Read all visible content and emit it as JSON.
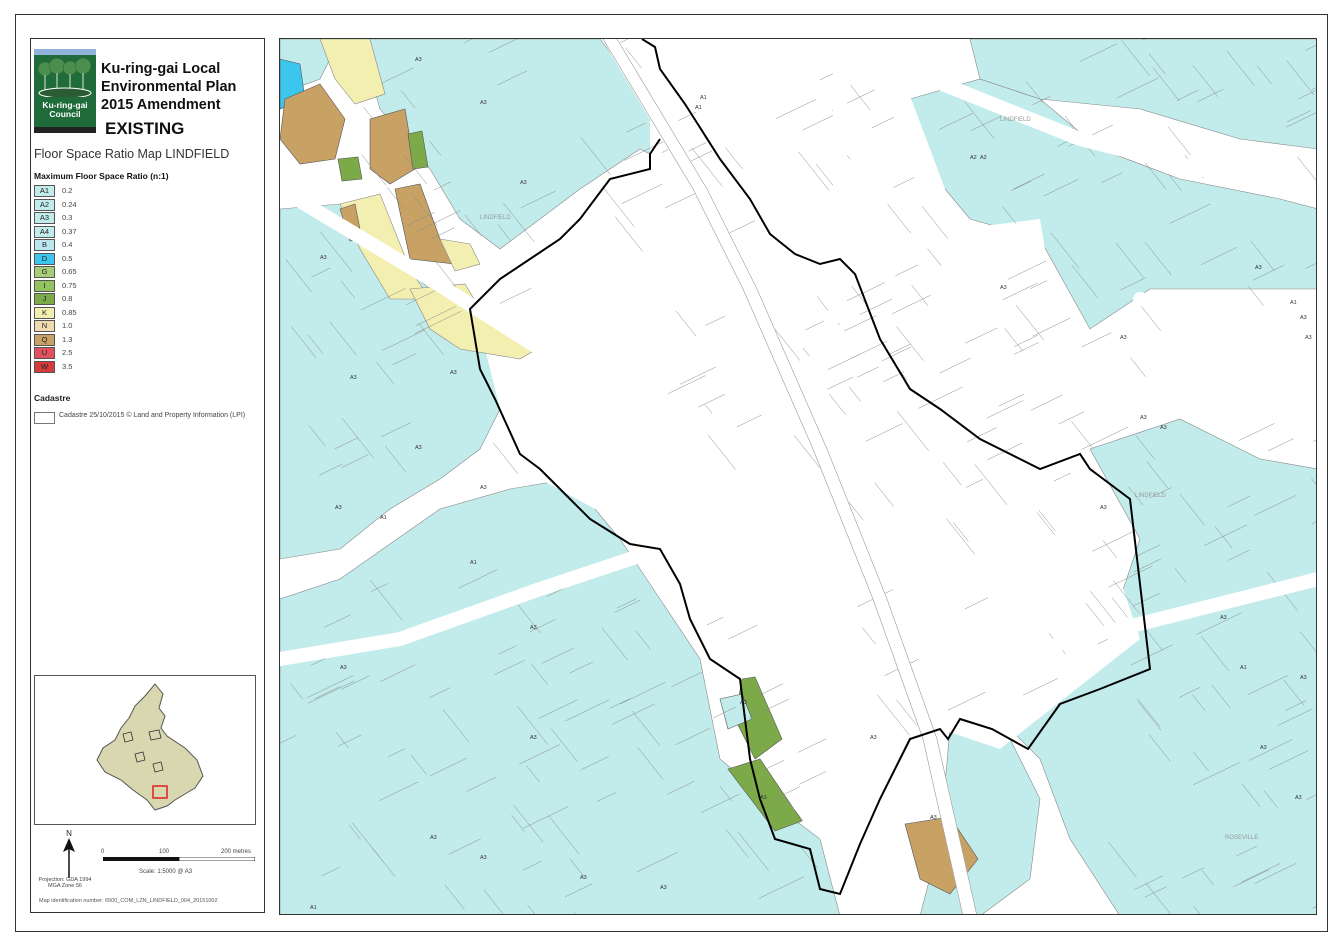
{
  "title_lines": [
    "Ku-ring-gai Local",
    "Environmental Plan",
    "2015 Amendment"
  ],
  "status": "EXISTING",
  "map_title": "Floor Space Ratio Map LINDFIELD",
  "logo_text": "Ku-ring-gai Council",
  "legend": {
    "heading": "Maximum Floor Space Ratio (n:1)",
    "items": [
      {
        "code": "A1",
        "value": "0.2",
        "color": "#c2ecec"
      },
      {
        "code": "A2",
        "value": "0.24",
        "color": "#c2ecec"
      },
      {
        "code": "A3",
        "value": "0.3",
        "color": "#c2ecec"
      },
      {
        "code": "A4",
        "value": "0.37",
        "color": "#c2ecec"
      },
      {
        "code": "B",
        "value": "0.4",
        "color": "#bde6ef"
      },
      {
        "code": "D",
        "value": "0.5",
        "color": "#3cc6ee"
      },
      {
        "code": "G",
        "value": "0.65",
        "color": "#a7cd7a"
      },
      {
        "code": "I",
        "value": "0.75",
        "color": "#92c35e"
      },
      {
        "code": "J",
        "value": "0.8",
        "color": "#7daa48"
      },
      {
        "code": "K",
        "value": "0.85",
        "color": "#f3efb1"
      },
      {
        "code": "N",
        "value": "1.0",
        "color": "#eedcb0"
      },
      {
        "code": "Q",
        "value": "1.3",
        "color": "#c8a164"
      },
      {
        "code": "U",
        "value": "2.5",
        "color": "#e0505f"
      },
      {
        "code": "W",
        "value": "3.5",
        "color": "#d23c3c"
      }
    ]
  },
  "cadastre": {
    "heading": "Cadastre",
    "text": "Cadastre 25/10/2015 © Land and Property Information (LPI)"
  },
  "north_label": "N",
  "projection": "Projection: GDA 1994 MGA Zone 56",
  "scale": {
    "labels": [
      "0",
      "100",
      "200 metres"
    ],
    "text": "Scale: 1:5000 @ A3"
  },
  "map_id": "Map identification number: 6500_COM_LZN_LINDFIELD_004_20151002",
  "map_labels": {
    "lindfield_1": "LINDFIELD",
    "lindfield_2": "LINDFIELD",
    "lindfield_3": "LINDFIELD",
    "roseville": "ROSEVILLE"
  },
  "zone_labels": [
    "A3",
    "A3",
    "A1",
    "A3",
    "A3",
    "A3",
    "A2",
    "A3",
    "A3",
    "A3",
    "A1",
    "A3",
    "A3",
    "A1",
    "A3",
    "A3",
    "A3",
    "A1",
    "A3",
    "A3",
    "A3",
    "A3",
    "A3",
    "A1",
    "A3",
    "A3",
    "A3",
    "A1",
    "A3",
    "A3",
    "A3",
    "A3",
    "A3",
    "A1",
    "A3",
    "A3",
    "A3",
    "A3",
    "A3",
    "A3",
    "A2",
    "A3"
  ],
  "map_colors": {
    "a": "#c2ecec",
    "d": "#3cc6ee",
    "g": "#c8a164",
    "j": "#7daa48",
    "k": "#f3efb1",
    "boundary": "#000000",
    "cadastre": "#888888"
  }
}
